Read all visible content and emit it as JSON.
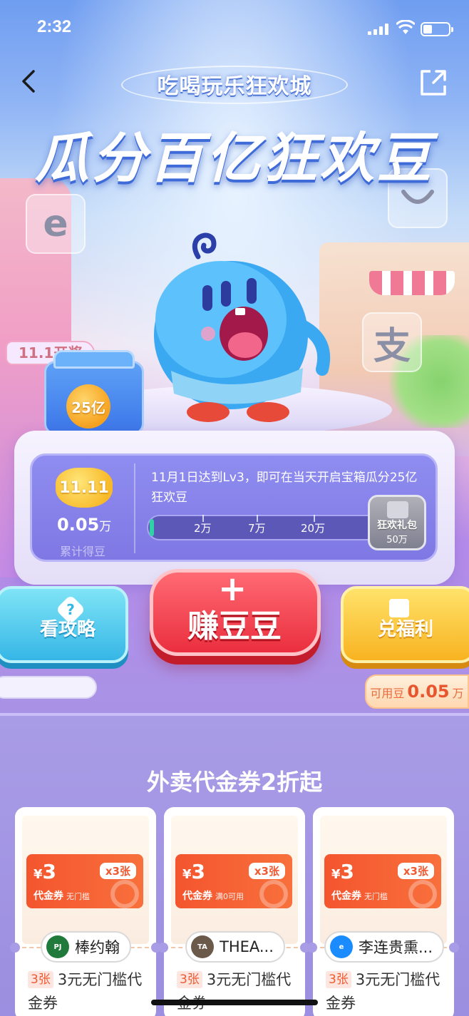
{
  "status_bar": {
    "time": "2:32"
  },
  "header": {
    "subtitle": "吃喝玩乐狂欢城",
    "title": "瓜分百亿狂欢豆"
  },
  "treasure": {
    "open_tag": "11.1开奖",
    "amount": "25亿"
  },
  "progress": {
    "coin_text": "11.11",
    "earned_value": "0.05",
    "earned_unit": "万",
    "earned_label": "累计得豆",
    "description": "11月1日达到Lv3，即可在当天开启宝箱瓜分25亿狂欢豆",
    "milestones": [
      "2万",
      "7万",
      "20万"
    ],
    "fill_fraction": 0.01,
    "gift_name": "狂欢礼包",
    "gift_amount": "50万"
  },
  "actions": {
    "guide_label": "看攻略",
    "earn_plus": "+",
    "earn_label": "赚豆豆",
    "redeem_label": "兑福利"
  },
  "beans": {
    "label": "可用豆",
    "value": "0.05",
    "unit": "万"
  },
  "section": {
    "title": "外卖代金券2折起"
  },
  "coupons": [
    {
      "amount": "3",
      "currency": "¥",
      "count_badge": "x3张",
      "type": "代金券",
      "condition": "无门槛",
      "shop": "棒约翰",
      "logo_color": "#1f7a3c",
      "qty": "3张",
      "desc": "3元无门槛代金券"
    },
    {
      "amount": "3",
      "currency": "¥",
      "count_badge": "x3张",
      "type": "代金券",
      "condition": "满0可用",
      "shop": "THEA...",
      "logo_color": "#6b5a4a",
      "qty": "3张",
      "desc": "3元无门槛代金券"
    },
    {
      "amount": "3",
      "currency": "¥",
      "count_badge": "x3张",
      "type": "代金券",
      "condition": "无门槛",
      "shop": "李连贵熏...",
      "logo_color": "#1a8cff",
      "qty": "3张",
      "desc": "3元无门槛代金券"
    }
  ]
}
